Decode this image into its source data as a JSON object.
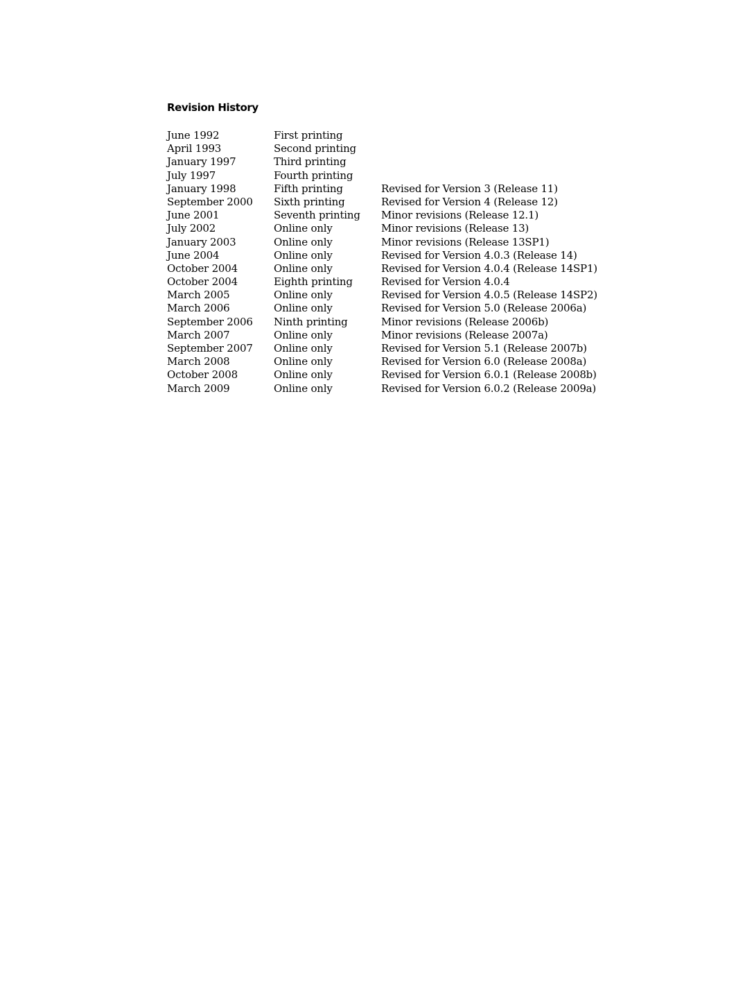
{
  "document": {
    "title": "Revision History",
    "rows": [
      {
        "date": "June 1992",
        "edition": "First printing",
        "note": ""
      },
      {
        "date": "April 1993",
        "edition": "Second printing",
        "note": ""
      },
      {
        "date": "January 1997",
        "edition": "Third printing",
        "note": ""
      },
      {
        "date": "July 1997",
        "edition": "Fourth printing",
        "note": ""
      },
      {
        "date": "January 1998",
        "edition": "Fifth printing",
        "note": "Revised for Version 3 (Release 11)"
      },
      {
        "date": "September 2000",
        "edition": "Sixth printing",
        "note": "Revised for Version 4 (Release 12)"
      },
      {
        "date": "June 2001",
        "edition": "Seventh printing",
        "note": "Minor revisions (Release 12.1)"
      },
      {
        "date": "July 2002",
        "edition": "Online only",
        "note": "Minor revisions (Release 13)"
      },
      {
        "date": "January 2003",
        "edition": "Online only",
        "note": "Minor revisions (Release 13SP1)"
      },
      {
        "date": "June 2004",
        "edition": "Online only",
        "note": "Revised for Version 4.0.3 (Release 14)"
      },
      {
        "date": "October 2004",
        "edition": "Online only",
        "note": "Revised for Version 4.0.4 (Release 14SP1)"
      },
      {
        "date": "October 2004",
        "edition": "Eighth printing",
        "note": "Revised for Version 4.0.4"
      },
      {
        "date": "March 2005",
        "edition": "Online only",
        "note": "Revised for Version 4.0.5 (Release 14SP2)"
      },
      {
        "date": "March 2006",
        "edition": "Online only",
        "note": "Revised for Version 5.0 (Release 2006a)"
      },
      {
        "date": "September 2006",
        "edition": "Ninth printing",
        "note": "Minor revisions (Release 2006b)"
      },
      {
        "date": "March 2007",
        "edition": "Online only",
        "note": "Minor revisions (Release 2007a)"
      },
      {
        "date": "September 2007",
        "edition": "Online only",
        "note": "Revised for Version 5.1 (Release 2007b)"
      },
      {
        "date": "March 2008",
        "edition": "Online only",
        "note": "Revised for Version 6.0 (Release 2008a)"
      },
      {
        "date": "October 2008",
        "edition": "Online only",
        "note": "Revised for Version 6.0.1 (Release 2008b)"
      },
      {
        "date": "March 2009",
        "edition": "Online only",
        "note": "Revised for Version 6.0.2 (Release 2009a)"
      }
    ]
  }
}
